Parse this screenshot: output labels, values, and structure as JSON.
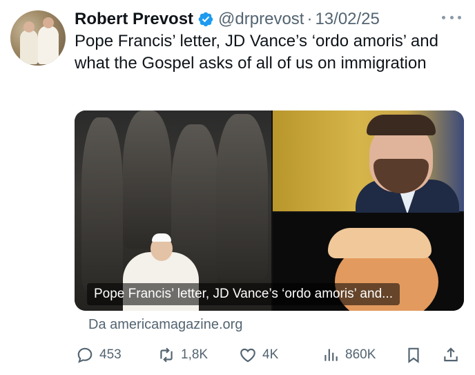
{
  "author": {
    "name": "Robert Prevost",
    "handle": "@drprevost",
    "separator": "·",
    "date": "13/02/25"
  },
  "tweet": {
    "text": "Pope Francis’ letter, JD Vance’s ‘ordo amoris’ and what the Gospel asks of all of us on immigration"
  },
  "card": {
    "caption": "Pope Francis’ letter, JD Vance’s ‘ordo amoris’ and...",
    "source": "Da americamagazine.org"
  },
  "actions": {
    "replies": "453",
    "reposts": "1,8K",
    "likes": "4K",
    "views": "860K"
  },
  "icons": {
    "verified": "verified-badge-icon",
    "more": "more-options-icon",
    "reply": "reply-icon",
    "repost": "repost-icon",
    "like": "like-icon",
    "views": "views-icon",
    "bookmark": "bookmark-icon",
    "share": "share-icon"
  },
  "colors": {
    "verified": "#1d9bf0",
    "secondary_text": "#536471",
    "primary_text": "#0f1419"
  }
}
